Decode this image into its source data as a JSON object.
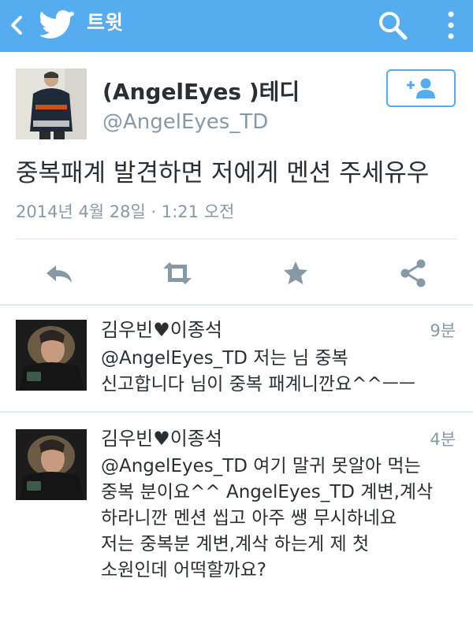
{
  "topbar": {
    "title": "트윗",
    "background_color": "#55acee",
    "icons": [
      "back-chevron-icon",
      "twitter-bird-icon",
      "search-icon",
      "more-vertical-icon"
    ]
  },
  "tweet": {
    "display_name": "(AngelEyes )테디",
    "handle": "@AngelEyes_TD",
    "text": "중복패계 발견하면 저에게 멘션 주세유우",
    "timestamp": "2014년 4월 28일 · 1:21 오전",
    "follow_icon": "add-user-icon",
    "actions": [
      "reply-icon",
      "retweet-icon",
      "favorite-star-icon",
      "share-icon"
    ]
  },
  "replies": [
    {
      "name": "김우빈♥이종석",
      "time": "9분",
      "text": "@AngelEyes_TD 저는 님 중복\n신고합니다 님이 중복 패계니깐요^^ㅡㅡ"
    },
    {
      "name": "김우빈♥이종석",
      "time": "4분",
      "text": "@AngelEyes_TD 여기 말귀 못알아 먹는\n중복 분이요^^ AngelEyes_TD 계변,계삭\n하라니깐 멘션 씹고 아주 쌩 무시하네요\n저는  중복분 계변,계삭 하는게 제 첫\n소원인데 어떡할까요?"
    }
  ],
  "colors": {
    "accent": "#55acee",
    "text": "#292f33",
    "secondary": "#8899a6",
    "divider": "#e1e8ed"
  }
}
